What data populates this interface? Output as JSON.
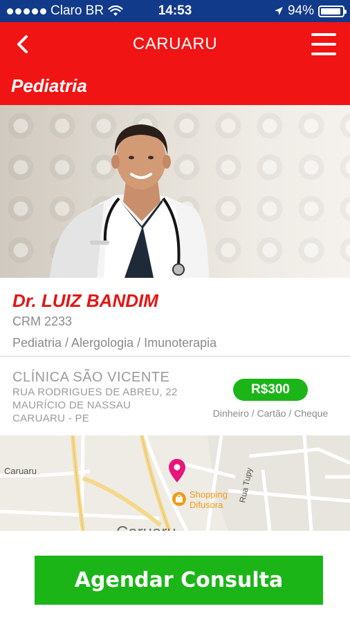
{
  "status_bar": {
    "carrier": "Claro BR",
    "time": "14:53",
    "battery": "94%",
    "battery_level": 0.94
  },
  "nav": {
    "title": "CARUARU",
    "back_icon": "chevron-left-icon",
    "menu_icon": "hamburger-menu-icon"
  },
  "specialty": {
    "title": "Pediatria"
  },
  "doctor": {
    "name": "Dr. LUIZ BANDIM",
    "crm": "CRM 2233",
    "specialties": "Pediatria / Alergologia / Imunoterapia"
  },
  "clinic": {
    "name": "CLÍNICA SÃO VICENTE",
    "address_line1": "RUA RODRIGUES DE ABREU, 22",
    "address_line2": "MAURÍCIO DE NASSAU",
    "address_line3": "CARUARU - PE"
  },
  "pricing": {
    "price": "R$300",
    "payment_methods": "Dinheiro / Cartão / Cheque"
  },
  "map": {
    "label_city_left": "Caruaru",
    "label_street": "Rua Tupy",
    "label_poi_line1": "Shopping",
    "label_poi_line2": "Difusora",
    "label_city_bottom": "Caruaru",
    "pin_icon": "map-pin-icon",
    "poi_icon": "shopping-bag-icon"
  },
  "cta": {
    "label": "Agendar Consulta"
  },
  "colors": {
    "status_bar": "#123a8a",
    "brand_red": "#f01414",
    "action_green": "#1bb518",
    "muted_text": "#8a8a8a",
    "pin_pink": "#e8157a",
    "poi_orange": "#f19a14"
  }
}
